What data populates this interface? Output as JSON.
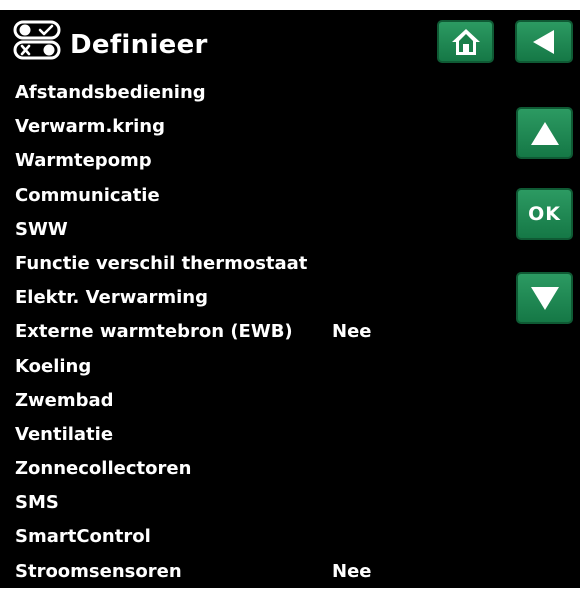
{
  "header": {
    "title": "Definieer",
    "icon": "toggle-switches-icon"
  },
  "buttons": {
    "home_icon": "home-icon",
    "back_icon": "back-arrow-icon",
    "up_icon": "up-arrow-icon",
    "ok_label": "OK",
    "down_icon": "down-arrow-icon"
  },
  "menu": {
    "items": [
      {
        "label": "Afstandsbediening",
        "value": ""
      },
      {
        "label": "Verwarm.kring",
        "value": ""
      },
      {
        "label": "Warmtepomp",
        "value": ""
      },
      {
        "label": "Communicatie",
        "value": ""
      },
      {
        "label": "SWW",
        "value": ""
      },
      {
        "label": "Functie verschil thermostaat",
        "value": ""
      },
      {
        "label": "Elektr. Verwarming",
        "value": ""
      },
      {
        "label": "Externe warmtebron (EWB)",
        "value": "Nee"
      },
      {
        "label": "Koeling",
        "value": ""
      },
      {
        "label": "Zwembad",
        "value": ""
      },
      {
        "label": "Ventilatie",
        "value": ""
      },
      {
        "label": "Zonnecollectoren",
        "value": ""
      },
      {
        "label": "SMS",
        "value": ""
      },
      {
        "label": "SmartControl",
        "value": ""
      },
      {
        "label": "Stroomsensoren",
        "value": "Nee"
      }
    ]
  },
  "colors": {
    "background": "#000000",
    "text": "#ffffff",
    "button_green": "#1e8a54"
  }
}
